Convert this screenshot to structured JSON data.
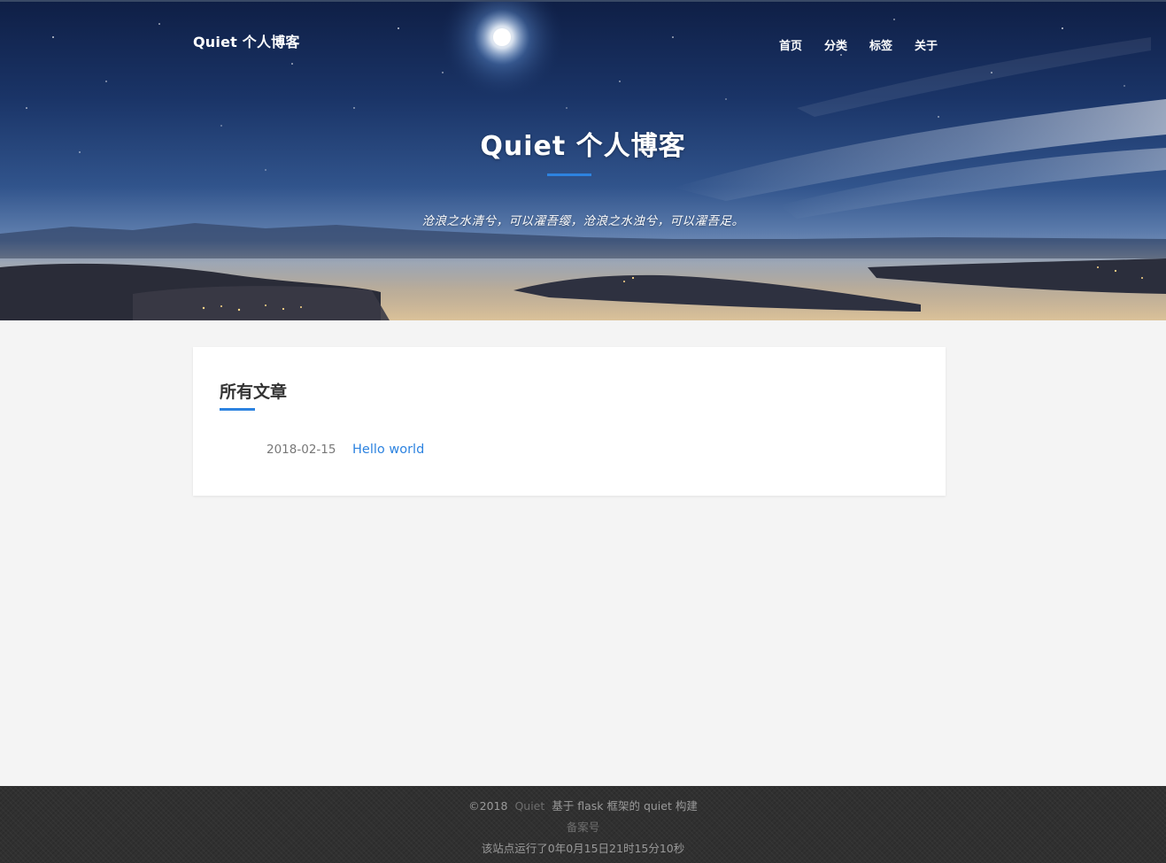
{
  "header": {
    "brand": "Quiet 个人博客",
    "nav": [
      {
        "label": "首页"
      },
      {
        "label": "分类"
      },
      {
        "label": "标签"
      },
      {
        "label": "关于"
      }
    ]
  },
  "hero": {
    "title": "Quiet 个人博客",
    "quote": "沧浪之水清兮，可以濯吾缨，沧浪之水浊兮，可以濯吾足。"
  },
  "main": {
    "section_title": "所有文章",
    "posts": [
      {
        "date": "2018-02-15",
        "title": "Hello world"
      }
    ]
  },
  "footer": {
    "copyright": "©2018",
    "site_name": "Quiet",
    "built_with": "基于 flask 框架的 quiet 构建",
    "icp": "备案号",
    "uptime": "该站点运行了0年0月15日21时15分10秒"
  },
  "colors": {
    "accent": "#2d83e0",
    "footer_bg": "#303030",
    "page_bg": "#f4f4f4"
  }
}
